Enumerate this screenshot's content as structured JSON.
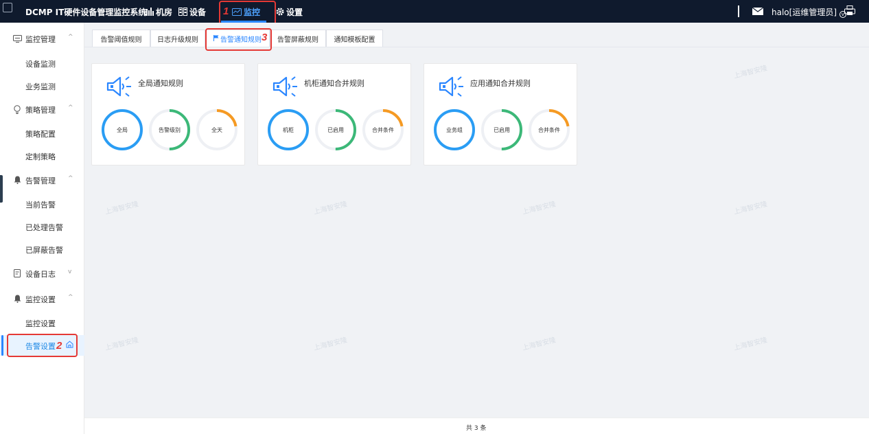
{
  "app": {
    "title": "DCMP IT硬件设备管理监控系统"
  },
  "topnav": {
    "items": [
      {
        "label": "机房",
        "icon": "bar-chart-icon"
      },
      {
        "label": "设备",
        "icon": "grid-icon"
      },
      {
        "label": "监控",
        "icon": "monitor-icon",
        "active": true
      },
      {
        "label": "设置",
        "icon": "gear-icon"
      }
    ],
    "user": "halo[运维管理员]"
  },
  "annotations": {
    "n1": "1",
    "n2": "2",
    "n3": "3"
  },
  "sidebar": {
    "groups": [
      {
        "label": "监控管理",
        "icon": "monitor-icon",
        "arrow": "^",
        "items": [
          "设备监测",
          "业务监测"
        ]
      },
      {
        "label": "策略管理",
        "icon": "lightbulb-icon",
        "arrow": "^",
        "items": [
          "策略配置",
          "定制策略"
        ]
      },
      {
        "label": "告警管理",
        "icon": "bell-icon",
        "arrow": "^",
        "items": [
          "当前告警",
          "已处理告警",
          "已屏蔽告警"
        ]
      },
      {
        "label": "设备日志",
        "icon": "document-icon",
        "arrow": "v",
        "items": []
      },
      {
        "label": "监控设置",
        "icon": "bell-icon",
        "arrow": "^",
        "items": [
          "监控设置",
          "告警设置"
        ]
      }
    ],
    "active_item": "告警设置",
    "collapse_glyph": "←"
  },
  "tabs": [
    {
      "label": "告警阈值规则"
    },
    {
      "label": "日志升级规则"
    },
    {
      "label": "告警通知规则",
      "active": true
    },
    {
      "label": "告警屏蔽规则"
    },
    {
      "label": "通知模板配置"
    }
  ],
  "cards": [
    {
      "title": "全局通知规则",
      "rings": [
        {
          "label": "全局",
          "color": "#2a9df4",
          "fraction": 1.0
        },
        {
          "label": "告警级别",
          "color": "#3cb878",
          "fraction": 0.5
        },
        {
          "label": "全天",
          "color": "#f59a23",
          "fraction": 0.22
        }
      ]
    },
    {
      "title": "机柜通知合并规则",
      "rings": [
        {
          "label": "机柜",
          "color": "#2a9df4",
          "fraction": 1.0
        },
        {
          "label": "已启用",
          "color": "#3cb878",
          "fraction": 0.5
        },
        {
          "label": "合并条件",
          "color": "#f59a23",
          "fraction": 0.22
        }
      ]
    },
    {
      "title": "应用通知合并规则",
      "rings": [
        {
          "label": "业务组",
          "color": "#2a9df4",
          "fraction": 1.0
        },
        {
          "label": "已启用",
          "color": "#3cb878",
          "fraction": 0.5
        },
        {
          "label": "合并条件",
          "color": "#f59a23",
          "fraction": 0.22
        }
      ]
    }
  ],
  "watermark": "上海智安隆",
  "footer": {
    "total": "共 3 条"
  }
}
